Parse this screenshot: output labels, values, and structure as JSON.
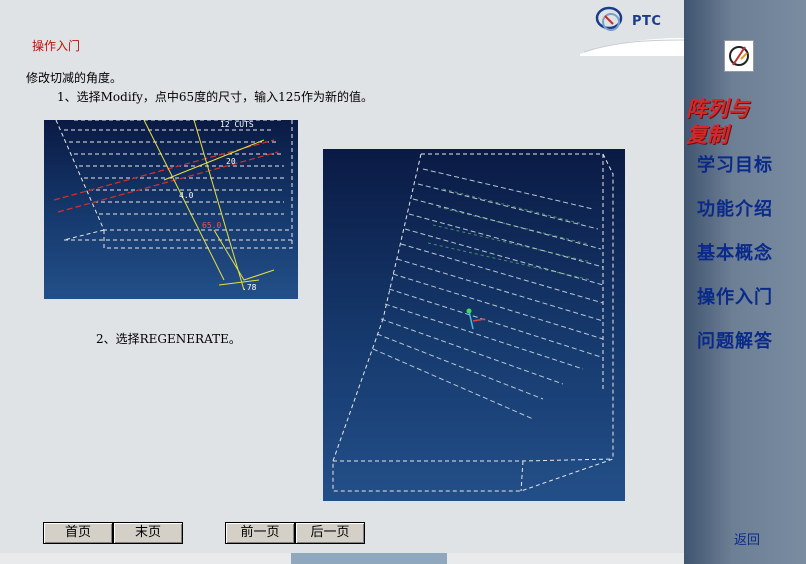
{
  "header": {
    "section_title": "操作入门",
    "logo_text": "PTC"
  },
  "content": {
    "intro": "修改切减的角度。",
    "step1": "1、选择Modify，点中65度的尺寸，输入125作为新的值。",
    "step2": "2、选择REGENERATE。",
    "figure1_dims": [
      "12 CUTS",
      "20",
      "65.0",
      "4.0",
      ".78"
    ]
  },
  "navigation": {
    "first": "首页",
    "last": "末页",
    "prev": "前一页",
    "next": "后一页"
  },
  "sidebar": {
    "topic_line1": "阵列与",
    "topic_line2": "复制",
    "items": [
      "学习目标",
      "功能介绍",
      "基本概念",
      "操作入门",
      "问题解答"
    ],
    "back": "返回"
  },
  "colors": {
    "accent_red": "#c0100a",
    "menu_blue": "#0a2a8a",
    "sidebar_bg": "#5a6e86",
    "viewport_bg": "#102a5a"
  }
}
